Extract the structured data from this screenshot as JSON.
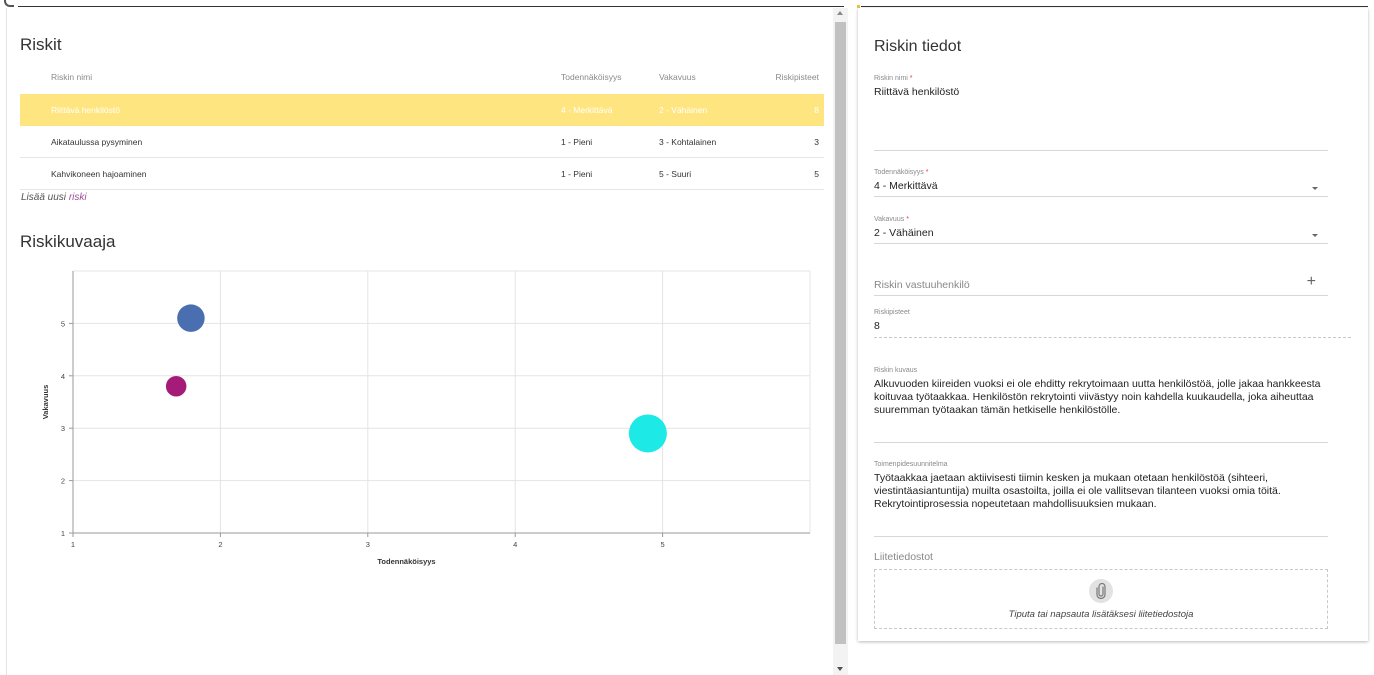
{
  "risks": {
    "title": "Riskit",
    "columns": {
      "name": "Riskin nimi",
      "probability": "Todennäköisyys",
      "severity": "Vakavuus",
      "points": "Riskipisteet"
    },
    "rows": [
      {
        "name": "Riittävä henkilöstö",
        "probability": "4 - Merkittävä",
        "severity": "2 - Vähäinen",
        "points": "8"
      },
      {
        "name": "Aikataulussa pysyminen",
        "probability": "1 - Pieni",
        "severity": "3 - Kohtalainen",
        "points": "3"
      },
      {
        "name": "Kahvikoneen hajoaminen",
        "probability": "1 - Pieni",
        "severity": "5 - Suuri",
        "points": "5"
      }
    ],
    "add_prefix": "Lisää uusi",
    "add_link": "riski"
  },
  "chart_section_title": "Riskikuvaaja",
  "chart_data": {
    "type": "scatter",
    "xlabel": "Todennäköisyys",
    "ylabel": "Vakavuus",
    "xlim": [
      1,
      6
    ],
    "ylim": [
      1,
      6
    ],
    "x_ticks": [
      1,
      2,
      3,
      4,
      5
    ],
    "y_ticks": [
      1,
      2,
      3,
      4,
      5
    ],
    "grid": true,
    "points": [
      {
        "x": 1.8,
        "y": 5.1,
        "size": 5,
        "color": "#4a6fb0"
      },
      {
        "x": 1.7,
        "y": 3.8,
        "size": 3,
        "color": "#a51c78"
      },
      {
        "x": 4.9,
        "y": 2.9,
        "size": 8,
        "color": "#1de9e6"
      }
    ]
  },
  "details": {
    "title": "Riskin tiedot",
    "name_label": "Riskin nimi",
    "name_value": "Riittävä henkilöstö",
    "probability_label": "Todennäköisyys",
    "probability_value": "4 - Merkittävä",
    "severity_label": "Vakavuus",
    "severity_value": "2 - Vähäinen",
    "owner_placeholder": "Riskin vastuuhenkilö",
    "points_label": "Riskipisteet",
    "points_value": "8",
    "description_label": "Riskin kuvaus",
    "description_value": "Alkuvuoden kiireiden vuoksi ei ole ehditty rekrytoimaan uutta henkilöstöä, jolle jakaa hankkeesta koituvaa työtaakkaa. Henkilöstön rekrytointi viivästyy noin kahdella kuukaudella, joka aiheuttaa suuremman työtaakan tämän hetkiselle henkilöstölle.",
    "plan_label": "Toimenpidesuunnitelma",
    "plan_value": "Työtaakkaa jaetaan aktiivisesti tiimin kesken ja mukaan otetaan henkilöstöä (sihteeri, viestintäasiantuntija) muilta osastoilta, joilla ei ole vallitsevan tilanteen vuoksi omia töitä. Rekrytointiprosessia nopeutetaan mahdollisuuksien mukaan.",
    "attachments_title": "Liitetiedostot",
    "dropzone_text": "Tiputa tai napsauta lisätäksesi liitetiedostoja",
    "required_mark": "*"
  },
  "colors": {
    "selected_row": "#ffe57f",
    "link": "#9c4f96",
    "required": "#e53935"
  },
  "icons": [
    "scroll-up-icon",
    "scroll-down-icon",
    "dropdown-arrow-icon",
    "plus-icon",
    "paperclip-icon"
  ]
}
